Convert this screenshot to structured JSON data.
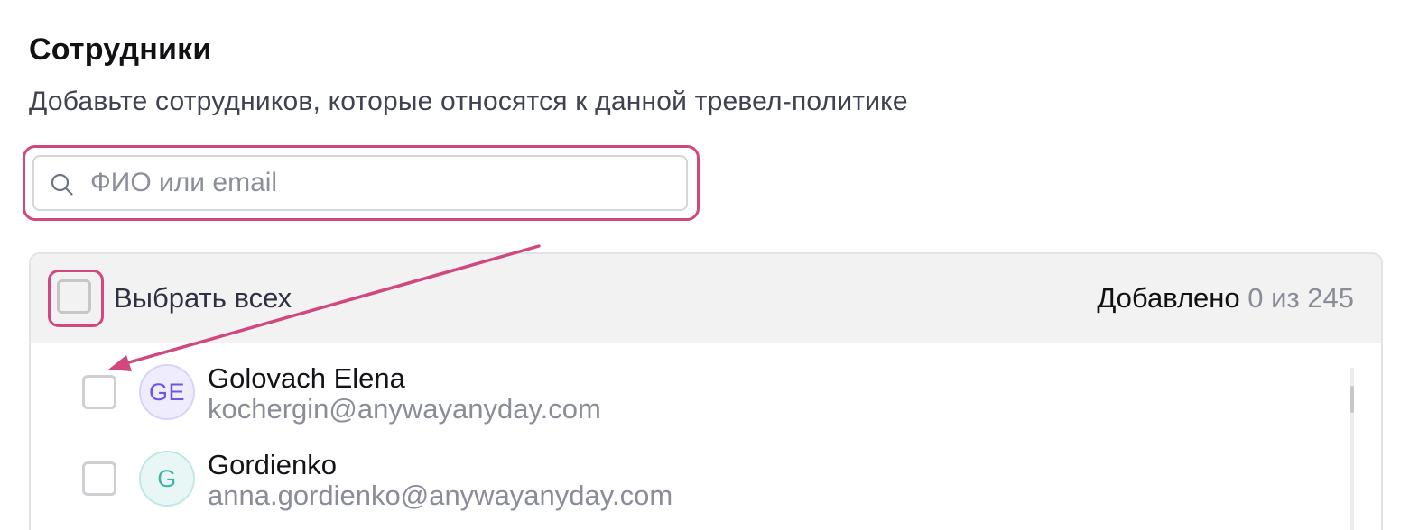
{
  "section": {
    "title": "Сотрудники",
    "subtitle": "Добавьте сотрудников, которые относятся к данной тревел-политике"
  },
  "search": {
    "placeholder": "ФИО или email",
    "value": "",
    "icon": "search-icon"
  },
  "list": {
    "select_all_label": "Выбрать всех",
    "counter_label": "Добавлено",
    "counter_value": "0 из 245",
    "employees": [
      {
        "initials": "GE",
        "name": "Golovach Elena",
        "email": "kochergin@anywayanyday.com",
        "avatar_color": "#6a55e8",
        "checked": false
      },
      {
        "initials": "G",
        "name": "Gordienko",
        "email": "anna.gordienko@anywayanyday.com",
        "avatar_color": "#3fb2aa",
        "checked": false
      }
    ]
  },
  "annotation": {
    "highlight_color": "#d0487d"
  }
}
